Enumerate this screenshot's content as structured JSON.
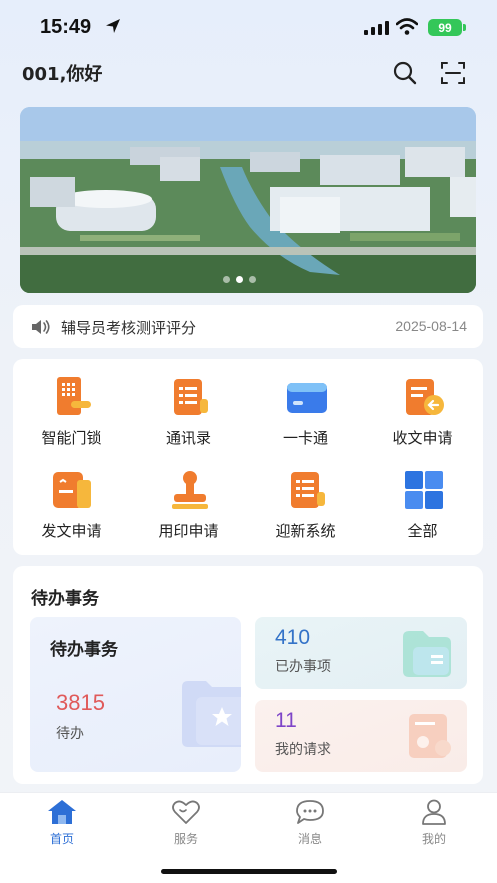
{
  "status_bar": {
    "time": "15:49",
    "battery": "99"
  },
  "header": {
    "greeting": "001,你好"
  },
  "banner": {
    "slides": 3,
    "active_slide": 2
  },
  "notice": {
    "text": "辅导员考核测评评分",
    "date": "2025-08-14"
  },
  "apps": [
    {
      "label": "智能门锁",
      "icon": "door-lock-icon"
    },
    {
      "label": "通讯录",
      "icon": "contacts-icon"
    },
    {
      "label": "一卡通",
      "icon": "card-icon"
    },
    {
      "label": "收文申请",
      "icon": "receive-document-icon"
    },
    {
      "label": "发文申请",
      "icon": "send-document-icon"
    },
    {
      "label": "用印申请",
      "icon": "stamp-icon"
    },
    {
      "label": "迎新系统",
      "icon": "welcome-system-icon"
    },
    {
      "label": "全部",
      "icon": "all-apps-icon"
    }
  ],
  "todo": {
    "title": "待办事务",
    "pending": {
      "title": "待办事务",
      "count": "3815",
      "label": "待办"
    },
    "done": {
      "count": "410",
      "label": "已办事项"
    },
    "requests": {
      "count": "11",
      "label": "我的请求"
    }
  },
  "tabs": [
    {
      "label": "首页",
      "active": true
    },
    {
      "label": "服务",
      "active": false
    },
    {
      "label": "消息",
      "active": false
    },
    {
      "label": "我的",
      "active": false
    }
  ],
  "colors": {
    "accent": "#2d6fd6",
    "pending_red": "#e05a5a",
    "done_blue": "#3473c8",
    "request_purple": "#7e45c8"
  }
}
